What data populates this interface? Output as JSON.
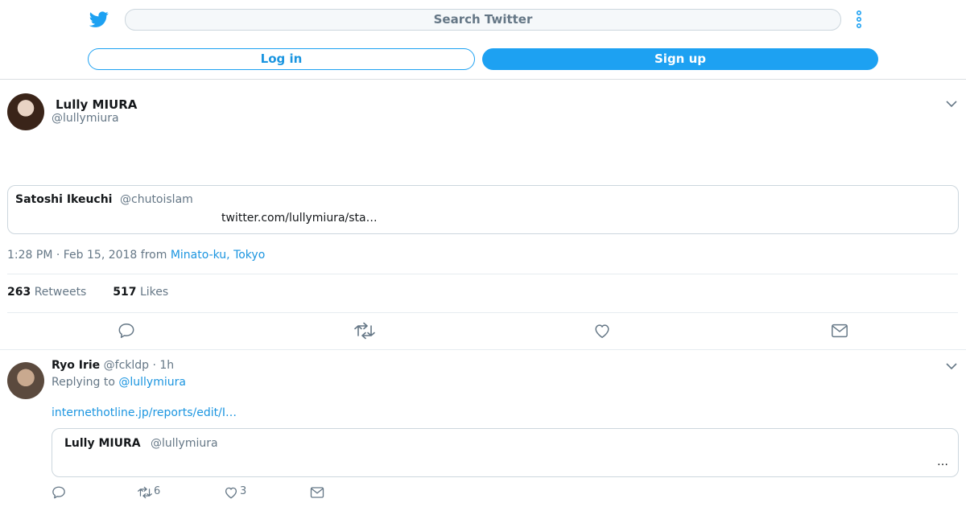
{
  "header": {
    "search_placeholder": "Search Twitter",
    "login_label": "Log in",
    "signup_label": "Sign up",
    "brand_color": "#1da1f2"
  },
  "tweet": {
    "author_name": "Lully MIURA",
    "author_handle": "@lullymiura",
    "quoted": {
      "name": "Satoshi Ikeuchi",
      "handle": "@chutoislam",
      "text": "twitter.com/lullymiura/sta…"
    },
    "time": "1:28 PM · Feb 15, 2018 from ",
    "location": "Minato-ku, Tokyo",
    "retweets_count": "263",
    "retweets_label": "Retweets",
    "likes_count": "517",
    "likes_label": "Likes",
    "actions": [
      "reply-icon",
      "retweet-icon",
      "like-icon",
      "message-icon"
    ]
  },
  "reply": {
    "name": "Ryo Irie",
    "handle": "@fckldp",
    "time": "· 1h",
    "replying_prefix": "Replying to ",
    "replying_to": "@lullymiura",
    "link": "internethotline.jp/reports/edit/I…",
    "quoted": {
      "name": "Lully MIURA",
      "handle": "@lullymiura",
      "text": "…"
    },
    "retweet_count": "6",
    "like_count": "3"
  }
}
